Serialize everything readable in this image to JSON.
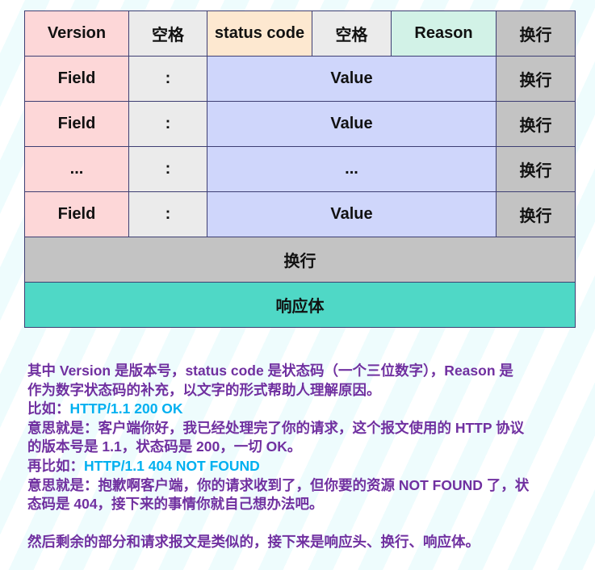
{
  "diagram": {
    "header_row": {
      "version": "Version",
      "space1": "空格",
      "status_code": "status code",
      "space2": "空格",
      "reason": "Reason",
      "crlf": "换行"
    },
    "header_fields": [
      {
        "field": "Field",
        "sep": ":",
        "value": "Value",
        "crlf": "换行"
      },
      {
        "field": "Field",
        "sep": ":",
        "value": "Value",
        "crlf": "换行"
      },
      {
        "field": "...",
        "sep": ":",
        "value": "...",
        "crlf": "换行"
      },
      {
        "field": "Field",
        "sep": ":",
        "value": "Value",
        "crlf": "换行"
      }
    ],
    "blank_line": "换行",
    "body": "响应体",
    "colors": {
      "version": "#fdd7d8",
      "space": "#ebebeb",
      "status_code": "#fde8d0",
      "reason": "#d2f2e7",
      "value": "#cfd6fb",
      "crlf": "#c3c3c3",
      "body": "#4fd8c6",
      "border": "#3e3f73"
    }
  },
  "explanation": {
    "line1": "其中 Version 是版本号，status code 是状态码（一个三位数字），Reason 是",
    "line2": "作为数字状态码的补充，以文字的形式帮助人理解原因。",
    "example1_prefix": "比如：",
    "example1_code": "HTTP/1.1 200 OK",
    "meaning1_line1": "意思就是：客户端你好，我已经处理完了你的请求，这个报文使用的 HTTP 协议",
    "meaning1_line2": "的版本号是 1.1，状态码是 200，一切 OK。",
    "example2_prefix": "再比如：",
    "example2_code": "HTTP/1.1 404 NOT FOUND",
    "meaning2_line1": "意思就是：抱歉啊客户端，你的请求收到了，但你要的资源 NOT FOUND 了，状",
    "meaning2_line2": "态码是 404，接下来的事情你就自己想办法吧。",
    "conclusion": "然后剩余的部分和请求报文是类似的，接下来是响应头、换行、响应体。",
    "colors": {
      "text": "#7030a0",
      "highlight": "#00b0f0"
    }
  }
}
